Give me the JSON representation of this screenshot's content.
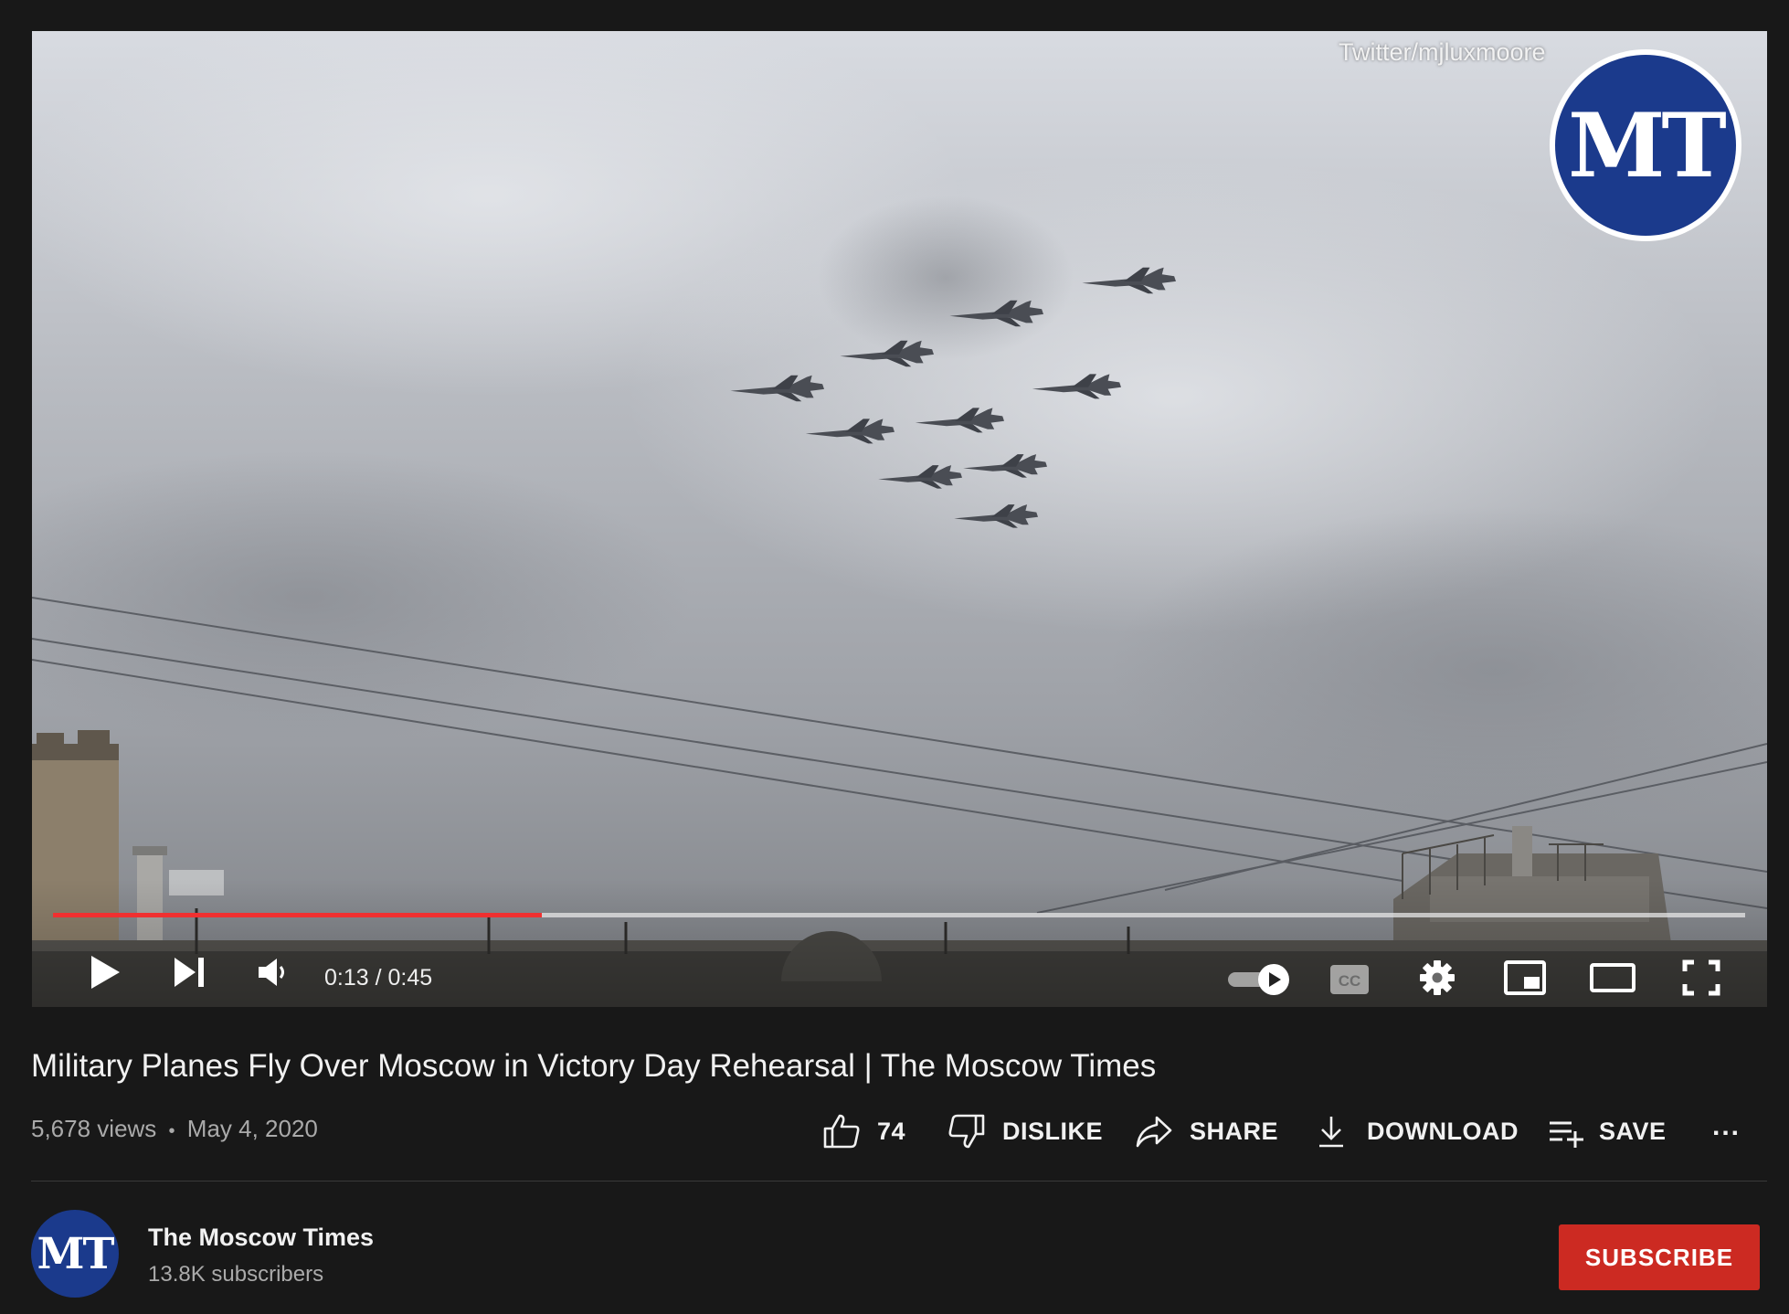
{
  "video": {
    "watermark_credit": "Twitter/mjluxmoore",
    "logo_text": "MT",
    "time_display": "0:13 / 0:45",
    "progress_fraction": 0.2889
  },
  "video_info": {
    "title": "Military Planes Fly Over Moscow in Victory Day Rehearsal | The Moscow Times",
    "views": "5,678 views",
    "separator": "•",
    "date": "May 4, 2020"
  },
  "actions": {
    "like_count": "74",
    "dislike_label": "DISLIKE",
    "share_label": "SHARE",
    "download_label": "DOWNLOAD",
    "save_label": "SAVE",
    "more_label": "..."
  },
  "channel": {
    "avatar_text": "MT",
    "name": "The Moscow Times",
    "subscribers": "13.8K subscribers",
    "subscribe_label": "SUBSCRIBE"
  },
  "colors": {
    "background": "#181818",
    "progress_played": "#f03030",
    "subscribe": "#cc2a22",
    "logo_blue": "#1b3a8c"
  }
}
